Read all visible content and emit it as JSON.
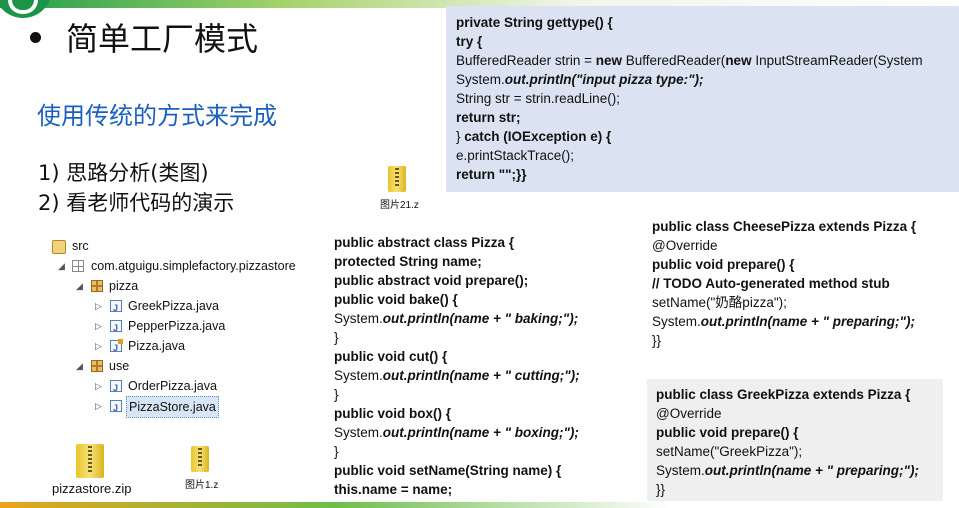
{
  "title": "简单工厂模式",
  "subtitle": "使用传统的方式来完成",
  "steps": [
    "1)  思路分析(类图)",
    "2)  看老师代码的演示"
  ],
  "attachments": {
    "pic21": "图片21.z",
    "pic1": "图片1.z",
    "zip": "pizzastore.zip"
  },
  "tree": {
    "src": "src",
    "package": "com.atguigu.simplefactory.pizzastore",
    "pizza": "pizza",
    "greek": "GreekPizza.java",
    "pepper": "PepperPizza.java",
    "pizzaJava": "Pizza.java",
    "use": "use",
    "order": "OrderPizza.java",
    "store": "PizzaStore.java"
  },
  "code_gettype": [
    [
      [
        "b",
        "private String gettype() {"
      ]
    ],
    [
      [
        "b",
        "try {"
      ]
    ],
    [
      [
        "n",
        "BufferedReader strin = "
      ],
      [
        "b",
        "new"
      ],
      [
        "n",
        " BufferedReader("
      ],
      [
        "b",
        "new"
      ],
      [
        "n",
        " InputStreamReader(System"
      ]
    ],
    [
      [
        "n",
        "System."
      ],
      [
        "bi",
        "out.println(\"input pizza type:\");"
      ]
    ],
    [
      [
        "n",
        "String str = strin.readLine();"
      ]
    ],
    [
      [
        "b",
        "return str;"
      ]
    ],
    [
      [
        "n",
        "} "
      ],
      [
        "b",
        "catch (IOException e) {"
      ]
    ],
    [
      [
        "n",
        "e.printStackTrace();"
      ]
    ],
    [
      [
        "b",
        "return \"\";}}"
      ]
    ]
  ],
  "code_pizza": [
    [
      [
        "b",
        "public abstract class Pizza {"
      ]
    ],
    [
      [
        "b",
        "protected String name;"
      ]
    ],
    [
      [
        "b",
        "public abstract void prepare();"
      ]
    ],
    [
      [
        "b",
        "public void bake() {"
      ]
    ],
    [
      [
        "n",
        "System."
      ],
      [
        "bi",
        "out.println(name + \" baking;\");"
      ]
    ],
    [
      [
        "n",
        "}"
      ]
    ],
    [
      [
        "b",
        "public void cut() {"
      ]
    ],
    [
      [
        "n",
        "System."
      ],
      [
        "bi",
        "out.println(name + \" cutting;\");"
      ]
    ],
    [
      [
        "n",
        "}"
      ]
    ],
    [
      [
        "b",
        "public void box() {"
      ]
    ],
    [
      [
        "n",
        "System."
      ],
      [
        "bi",
        "out.println(name + \" boxing;\");"
      ]
    ],
    [
      [
        "n",
        "}"
      ]
    ],
    [
      [
        "b",
        "public void setName(String name) {"
      ]
    ],
    [
      [
        "b",
        "this.name = name;"
      ]
    ],
    [
      [
        "n",
        "}}"
      ]
    ]
  ],
  "code_cheese": [
    [
      [
        "b",
        "public class CheesePizza extends Pizza {"
      ]
    ],
    [
      [
        "n",
        "@Override"
      ]
    ],
    [
      [
        "b",
        "public void prepare() {"
      ]
    ],
    [
      [
        "b",
        "// TODO Auto-generated method stub"
      ]
    ],
    [
      [
        "n",
        "setName(\"奶酪pizza\");"
      ]
    ],
    [
      [
        "n",
        "System."
      ],
      [
        "bi",
        "out.println(name + \" preparing;\");"
      ]
    ],
    [
      [
        "n",
        "}}"
      ]
    ]
  ],
  "code_greek": [
    [
      [
        "b",
        "public class GreekPizza extends Pizza {"
      ]
    ],
    [
      [
        "n",
        "@Override"
      ]
    ],
    [
      [
        "b",
        "public void prepare() {"
      ]
    ],
    [
      [
        "n",
        "setName(\"GreekPizza\");"
      ]
    ],
    [
      [
        "n",
        "System."
      ],
      [
        "bi",
        "out.println(name + \" preparing;\");"
      ]
    ],
    [
      [
        "n",
        "}}"
      ]
    ]
  ]
}
